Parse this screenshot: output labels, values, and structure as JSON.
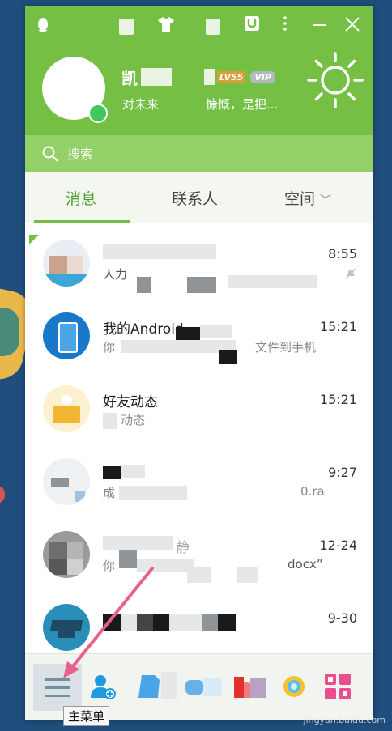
{
  "header": {
    "nickname": "凯",
    "level_badge": "LV55",
    "vip_badge": "VIP",
    "signature_start": "对未来",
    "signature_end": "慷慨，是把..."
  },
  "search": {
    "placeholder": "搜索"
  },
  "tabs": [
    {
      "label": "消息",
      "active": true
    },
    {
      "label": "联系人",
      "active": false
    },
    {
      "label": "空间",
      "active": false
    }
  ],
  "conversations": [
    {
      "title": "",
      "preview": "人力",
      "time": "8:55",
      "muted": true
    },
    {
      "title": "我的Android",
      "preview": "你",
      "preview_end": "文件到手机",
      "time": "15:21"
    },
    {
      "title": "好友动态",
      "preview": "动态",
      "time": "15:21"
    },
    {
      "title": "",
      "preview": "成",
      "preview_end": "0.ra",
      "time": "9:27"
    },
    {
      "title": "静",
      "preview": "你",
      "preview_end": "docx”",
      "time": "12-24"
    },
    {
      "title": "",
      "preview": "",
      "time": "9-30"
    }
  ],
  "toolbar": {
    "tooltip": "主菜单"
  },
  "watermark": "jingyan.baidu.com",
  "colors": {
    "accent": "#75c044",
    "window_bg": "#ffffff",
    "desktop": "#1f4e7d",
    "arrow": "#e8618c"
  }
}
